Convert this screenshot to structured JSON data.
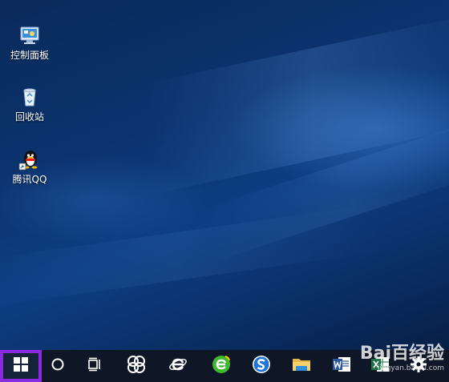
{
  "desktop": {
    "icons": [
      {
        "label": "控制面板",
        "icon": "control-panel-icon"
      },
      {
        "label": "回收站",
        "icon": "recycle-bin-icon"
      },
      {
        "label": "腾讯QQ",
        "icon": "qq-penguin-icon"
      }
    ]
  },
  "taskbar": {
    "buttons": [
      {
        "name": "start",
        "icon": "windows-logo-icon",
        "highlight_color": "#8a2be2"
      },
      {
        "name": "cortana",
        "icon": "cortana-circle-icon"
      },
      {
        "name": "task-view",
        "icon": "task-view-icon"
      },
      {
        "name": "pinwheel-app",
        "icon": "pinwheel-icon"
      },
      {
        "name": "internet-explorer",
        "icon": "ie-icon"
      },
      {
        "name": "360-browser",
        "icon": "green-e-browser-icon"
      },
      {
        "name": "sogou-browser",
        "icon": "sogou-s-icon"
      },
      {
        "name": "file-explorer",
        "icon": "folder-icon"
      },
      {
        "name": "word",
        "icon": "word-icon"
      },
      {
        "name": "excel",
        "icon": "excel-icon"
      },
      {
        "name": "settings",
        "icon": "gear-icon"
      }
    ]
  },
  "watermark": {
    "text": "Bai百经验",
    "sub": "jingyan.baidu.com"
  }
}
